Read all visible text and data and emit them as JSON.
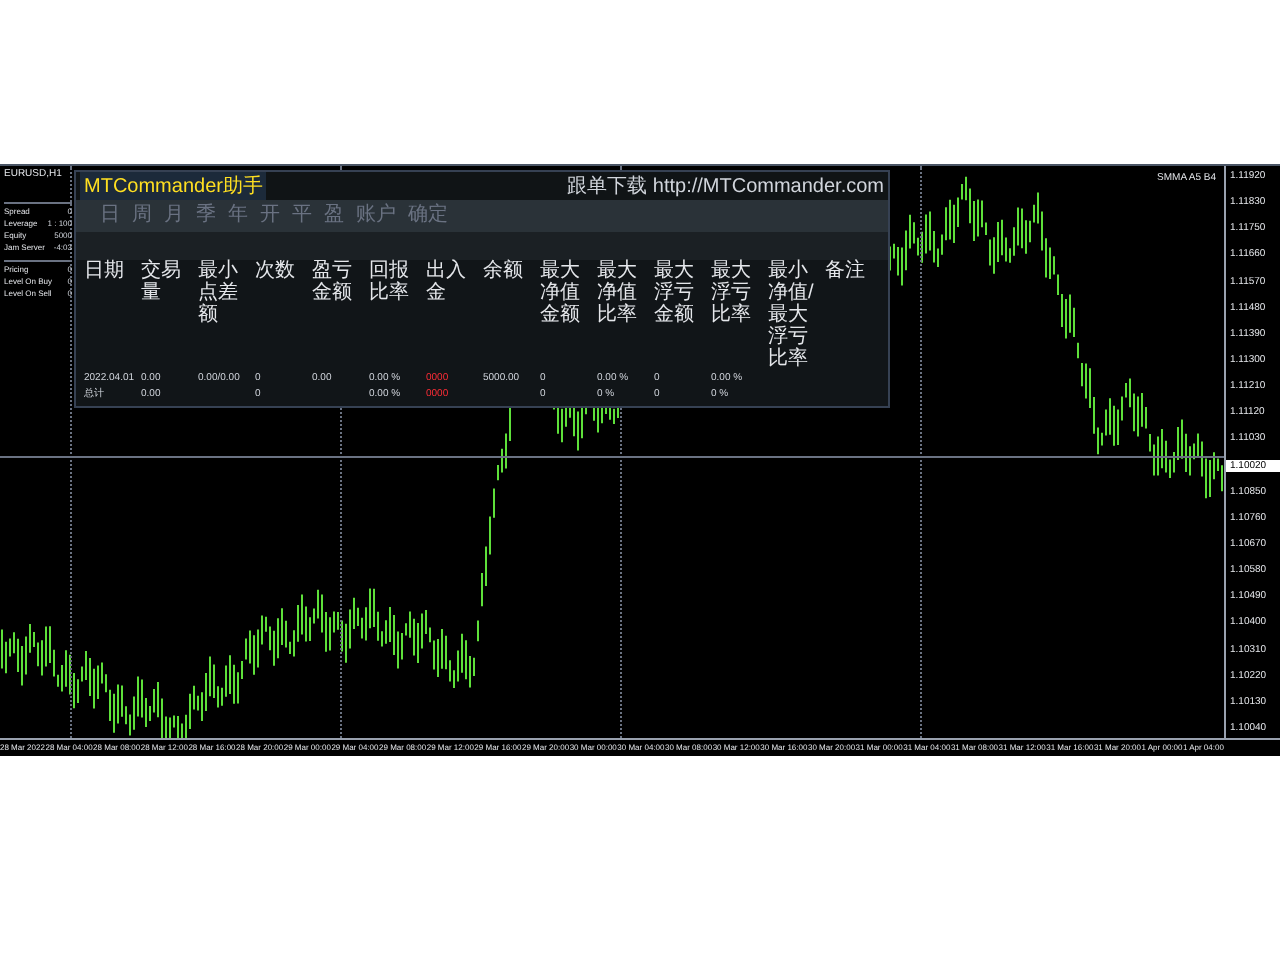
{
  "chart": {
    "symbol": "EURUSD,H1",
    "indicator": "SMMA A5 B4",
    "price_axis": [
      {
        "text": "1.11920",
        "current": false
      },
      {
        "text": "1.11830",
        "current": false
      },
      {
        "text": "1.11750",
        "current": false
      },
      {
        "text": "1.11660",
        "current": false
      },
      {
        "text": "1.11570",
        "current": false
      },
      {
        "text": "1.11480",
        "current": false
      },
      {
        "text": "1.11390",
        "current": false
      },
      {
        "text": "1.11300",
        "current": false
      },
      {
        "text": "1.11210",
        "current": false
      },
      {
        "text": "1.11120",
        "current": false
      },
      {
        "text": "1.11030",
        "current": false
      },
      {
        "text": "1.10020",
        "current": true
      },
      {
        "text": "1.10850",
        "current": false
      },
      {
        "text": "1.10760",
        "current": false
      },
      {
        "text": "1.10670",
        "current": false
      },
      {
        "text": "1.10580",
        "current": false
      },
      {
        "text": "1.10490",
        "current": false
      },
      {
        "text": "1.10400",
        "current": false
      },
      {
        "text": "1.10310",
        "current": false
      },
      {
        "text": "1.10220",
        "current": false
      },
      {
        "text": "1.10130",
        "current": false
      },
      {
        "text": "1.10040",
        "current": false
      }
    ],
    "time_axis": [
      "28 Mar 2022",
      "28 Mar 04:00",
      "28 Mar 08:00",
      "28 Mar 12:00",
      "28 Mar 16:00",
      "28 Mar 20:00",
      "29 Mar 00:00",
      "29 Mar 04:00",
      "29 Mar 08:00",
      "29 Mar 12:00",
      "29 Mar 16:00",
      "29 Mar 20:00",
      "30 Mar 00:00",
      "30 Mar 04:00",
      "30 Mar 08:00",
      "30 Mar 12:00",
      "30 Mar 16:00",
      "30 Mar 20:00",
      "31 Mar 00:00",
      "31 Mar 04:00",
      "31 Mar 08:00",
      "31 Mar 12:00",
      "31 Mar 16:00",
      "31 Mar 20:00",
      "1 Apr 00:00",
      "1 Apr 04:00"
    ]
  },
  "info_panel": {
    "groups": [
      [
        {
          "label": "Spread",
          "value": "0"
        },
        {
          "label": "Leverage",
          "value": "1 : 100"
        },
        {
          "label": "Equity",
          "value": "5000"
        },
        {
          "label": "Jam Server",
          "value": "-4:03"
        }
      ],
      [
        {
          "label": "Pricing",
          "value": "0"
        },
        {
          "label": "Level On Buy",
          "value": "0"
        },
        {
          "label": "Level On Sell",
          "value": "0"
        }
      ]
    ]
  },
  "commander": {
    "title": "MTCommander助手",
    "link": "跟单下载 http://MTCommander.com",
    "toolbar": [
      "日",
      "周",
      "月",
      "季",
      "年",
      "开",
      "平",
      "盈",
      "账户",
      "确定"
    ],
    "table": {
      "columns": [
        "日期",
        "交易量",
        "最小点差额",
        "次数",
        "盈亏金额",
        "回报比率",
        "出入金",
        "余额",
        "最大净值金额",
        "最大净值比率",
        "最大浮亏金额",
        "最大浮亏比率",
        "最小净值/最大浮亏比率",
        "备注"
      ],
      "rows": [
        [
          "2022.04.01",
          "0.00",
          "0.00/0.00",
          "0",
          "0.00",
          "0.00 %",
          {
            "text": "0000",
            "negative": true
          },
          "5000.00",
          "0",
          "0.00 %",
          "0",
          "0.00 %",
          "",
          ""
        ],
        [
          "总计",
          "0.00",
          "",
          "0",
          "",
          "0.00 %",
          {
            "text": "0000",
            "negative": true
          },
          "",
          "0",
          "0 %",
          "0",
          "0 %",
          "",
          ""
        ]
      ]
    }
  }
}
